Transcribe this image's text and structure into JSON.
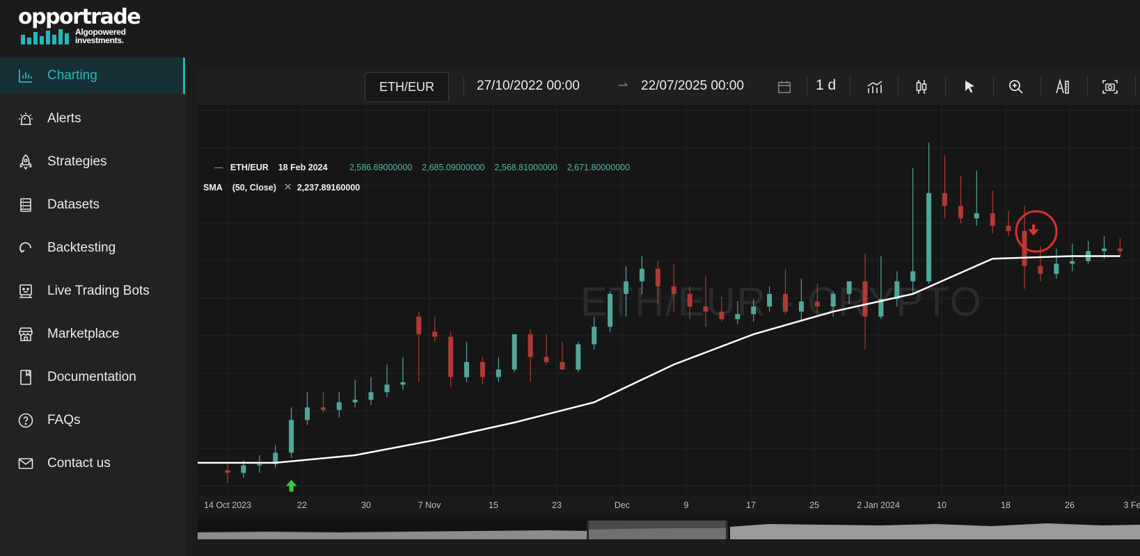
{
  "brand": {
    "logo_text": "opportrade",
    "tagline_line1": "Algopowered",
    "tagline_line2": "investments."
  },
  "sidebar": {
    "items": [
      {
        "label": "Charting",
        "icon": "bar-chart-icon",
        "active": true
      },
      {
        "label": "Alerts",
        "icon": "alarm-light-icon",
        "active": false
      },
      {
        "label": "Strategies",
        "icon": "rocket-icon",
        "active": false
      },
      {
        "label": "Datasets",
        "icon": "server-icon",
        "active": false
      },
      {
        "label": "Backtesting",
        "icon": "refresh-icon",
        "active": false
      },
      {
        "label": "Live Trading Bots",
        "icon": "robot-icon",
        "active": false
      },
      {
        "label": "Marketplace",
        "icon": "store-icon",
        "active": false
      },
      {
        "label": "Documentation",
        "icon": "book-icon",
        "active": false
      },
      {
        "label": "FAQs",
        "icon": "question-circle-icon",
        "active": false
      },
      {
        "label": "Contact us",
        "icon": "envelope-icon",
        "active": false
      }
    ]
  },
  "toolbar": {
    "symbol": "ETH/EUR",
    "date_from": "27/10/2022 00:00",
    "date_to": "22/07/2025 00:00",
    "interval": "1 d",
    "icons": [
      "calendar-icon",
      "indicators-icon",
      "candlestick-icon",
      "cursor-icon",
      "zoom-icon",
      "drawing-tools-icon",
      "screenshot-icon"
    ]
  },
  "legend": {
    "symbol": "ETH/EUR",
    "date": "18 Feb 2024",
    "open": "2,586.69000000",
    "high": "2,685.09000000",
    "low": "2,568.81000000",
    "close": "2,671.80000000",
    "indicator_name": "SMA",
    "indicator_params": "(50, Close)",
    "indicator_value": "2,237.89160000"
  },
  "watermark": "ETH/EUR - CRYPTO",
  "colors": {
    "accent": "#26b5b9",
    "up": "#4fa79a",
    "down": "#b03a34",
    "sma": "#ffffff",
    "buy_marker": "#2ecc40",
    "sell_marker": "#d7322b"
  },
  "chart_data": {
    "type": "candlestick",
    "x_unit": "date",
    "x_tick_labels": [
      "14 Oct 2023",
      "22",
      "30",
      "7 Nov",
      "15",
      "23",
      "Dec",
      "9",
      "17",
      "25",
      "2 Jan 2024",
      "10",
      "18",
      "26",
      "3 Fe"
    ],
    "ylim": [
      1350,
      2900
    ],
    "series": [
      {
        "name": "ETH/EUR",
        "kind": "ohlc",
        "x": [
          "2023-10-14",
          "2023-10-16",
          "2023-10-18",
          "2023-10-20",
          "2023-10-22",
          "2023-10-24",
          "2023-10-26",
          "2023-10-28",
          "2023-10-30",
          "2023-11-01",
          "2023-11-03",
          "2023-11-05",
          "2023-11-07",
          "2023-11-09",
          "2023-11-11",
          "2023-11-13",
          "2023-11-15",
          "2023-11-17",
          "2023-11-19",
          "2023-11-21",
          "2023-11-23",
          "2023-11-25",
          "2023-11-27",
          "2023-11-29",
          "2023-12-01",
          "2023-12-03",
          "2023-12-05",
          "2023-12-07",
          "2023-12-09",
          "2023-12-11",
          "2023-12-13",
          "2023-12-15",
          "2023-12-17",
          "2023-12-19",
          "2023-12-21",
          "2023-12-23",
          "2023-12-25",
          "2023-12-27",
          "2023-12-29",
          "2023-12-31",
          "2024-01-02",
          "2024-01-04",
          "2024-01-06",
          "2024-01-08",
          "2024-01-10",
          "2024-01-12",
          "2024-01-14",
          "2024-01-16",
          "2024-01-18",
          "2024-01-20",
          "2024-01-22",
          "2024-01-24",
          "2024-01-26",
          "2024-01-28",
          "2024-01-30",
          "2024-02-01",
          "2024-02-03"
        ],
        "open": [
          1450,
          1440,
          1470,
          1475,
          1520,
          1650,
          1700,
          1690,
          1720,
          1730,
          1760,
          1790,
          2060,
          2000,
          1980,
          1820,
          1880,
          1820,
          1850,
          1990,
          1900,
          1880,
          1850,
          1950,
          2020,
          2150,
          2200,
          2250,
          2180,
          2150,
          2100,
          2080,
          2050,
          2070,
          2100,
          2150,
          2080,
          2120,
          2100,
          2150,
          2200,
          2060,
          2130,
          2200,
          2200,
          2550,
          2500,
          2450,
          2470,
          2420,
          2400,
          2260,
          2230,
          2270,
          2280,
          2320,
          2330
        ],
        "high": [
          1480,
          1490,
          1510,
          1550,
          1700,
          1760,
          1760,
          1760,
          1810,
          1820,
          1870,
          1900,
          2080,
          2060,
          2000,
          1960,
          1900,
          1900,
          1990,
          2010,
          1990,
          1960,
          1960,
          2060,
          2160,
          2260,
          2300,
          2280,
          2270,
          2180,
          2220,
          2140,
          2120,
          2130,
          2180,
          2250,
          2210,
          2190,
          2160,
          2200,
          2310,
          2300,
          2240,
          2650,
          2750,
          2700,
          2620,
          2640,
          2560,
          2480,
          2500,
          2340,
          2330,
          2350,
          2360,
          2380,
          2370
        ],
        "low": [
          1400,
          1420,
          1440,
          1460,
          1500,
          1630,
          1680,
          1660,
          1700,
          1710,
          1740,
          1770,
          1800,
          1960,
          1780,
          1800,
          1790,
          1800,
          1840,
          1800,
          1870,
          1860,
          1840,
          1930,
          2000,
          2060,
          2150,
          2110,
          2080,
          2050,
          2020,
          2040,
          2030,
          2040,
          2080,
          2070,
          2040,
          2060,
          2060,
          2110,
          1930,
          2050,
          2100,
          2150,
          2190,
          2450,
          2430,
          2420,
          2390,
          2380,
          2170,
          2200,
          2210,
          2240,
          2270,
          2290,
          2300
        ],
        "close": [
          1440,
          1470,
          1475,
          1520,
          1650,
          1700,
          1690,
          1720,
          1730,
          1760,
          1790,
          1800,
          1990,
          1980,
          1820,
          1880,
          1820,
          1850,
          1990,
          1900,
          1880,
          1850,
          1950,
          2020,
          2150,
          2200,
          2250,
          2180,
          2150,
          2100,
          2080,
          2050,
          2070,
          2100,
          2150,
          2080,
          2120,
          2100,
          2150,
          2200,
          2060,
          2130,
          2200,
          2240,
          2550,
          2500,
          2450,
          2470,
          2420,
          2400,
          2260,
          2230,
          2270,
          2280,
          2320,
          2330,
          2320
        ]
      },
      {
        "name": "SMA",
        "kind": "line",
        "x": [
          "2023-10-10",
          "2023-10-20",
          "2023-10-30",
          "2023-11-09",
          "2023-11-19",
          "2023-11-29",
          "2023-12-09",
          "2023-12-19",
          "2023-12-29",
          "2024-01-08",
          "2024-01-18",
          "2024-01-28",
          "2024-02-03"
        ],
        "y": [
          1480,
          1480,
          1510,
          1570,
          1640,
          1720,
          1870,
          1990,
          2080,
          2150,
          2290,
          2300,
          2300
        ]
      }
    ],
    "markers": [
      {
        "type": "buy",
        "x": "2023-10-22"
      },
      {
        "type": "sell",
        "x": "2024-01-22"
      }
    ],
    "grid": true
  }
}
